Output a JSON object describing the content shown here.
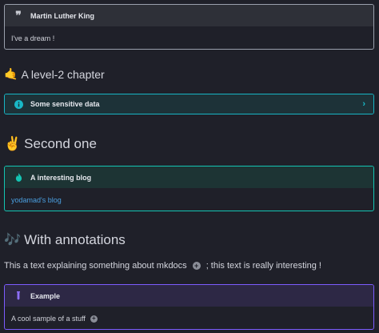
{
  "quote": {
    "title": "Martin Luther King",
    "icon": "quote-icon",
    "body": "I've a dream !"
  },
  "heading_level2": {
    "emoji": "🤙",
    "text": "A level-2 chapter"
  },
  "sensitive": {
    "title": "Some sensitive data",
    "icon": "info-icon",
    "chevron": "chevron-right-icon"
  },
  "heading_second": {
    "emoji": "✌️",
    "text": "Second one"
  },
  "blog": {
    "title": "A interesting blog",
    "icon": "flame-icon",
    "link": "yodamad's blog"
  },
  "heading_annotations": {
    "emoji": "🎶",
    "text": "With annotations"
  },
  "paragraph": {
    "before": "This a text explaining something about mkdocs",
    "after": "; this text is really interesting !",
    "annotation_marker": "+"
  },
  "example": {
    "title": "Example",
    "icon": "flask-icon",
    "body": "A cool sample of a stuff",
    "annotation_marker": "+"
  },
  "colors": {
    "background": "#1f2029",
    "quote_border": "#9aa0ad",
    "info_accent": "#18b5c4",
    "tip_accent": "#14c5b3",
    "example_accent": "#7c5cff",
    "link": "#4a9fe0"
  }
}
